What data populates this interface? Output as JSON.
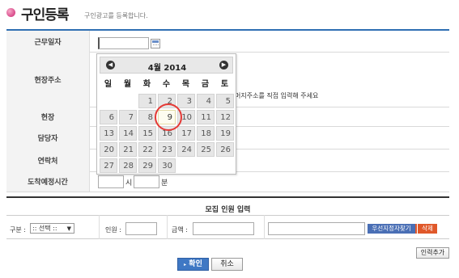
{
  "page": {
    "title": "구인등록",
    "subtitle": "구인광고를 등록합니다."
  },
  "form": {
    "work_date_label": "근무일자",
    "site_address_label": "현장주소",
    "address_hint": "머지주소를 직접 입력해 주세요",
    "site_label": "현장",
    "manager_label": "담당자",
    "contact_label": "연락처",
    "arrival_time_label": "도착예정시간",
    "hour_unit": "시",
    "minute_unit": "분"
  },
  "datepicker": {
    "title": "4월 2014",
    "prev": "◀",
    "next": "▶",
    "weekdays": [
      "일",
      "월",
      "화",
      "수",
      "목",
      "금",
      "토"
    ],
    "selected_day": "9",
    "weeks": [
      [
        "",
        "",
        "1",
        "2",
        "3",
        "4",
        "5"
      ],
      [
        "6",
        "7",
        "8",
        "9",
        "10",
        "11",
        "12"
      ],
      [
        "13",
        "14",
        "15",
        "16",
        "17",
        "18",
        "19"
      ],
      [
        "20",
        "21",
        "22",
        "23",
        "24",
        "25",
        "26"
      ],
      [
        "27",
        "28",
        "29",
        "30",
        "",
        "",
        ""
      ]
    ]
  },
  "recruit": {
    "section_title": "모집 인원 입력",
    "category_label": "구분 :",
    "category_select": ":: 선택 ::",
    "headcount_label": "인원 :",
    "amount_label": "금액 :",
    "find_route_button": "우선지정자찾기",
    "delete_button": "삭제",
    "add_input_button": "인력추가"
  },
  "actions": {
    "confirm": "확인",
    "cancel": "취소"
  },
  "colors": {
    "accent_blue": "#2f6fb3",
    "highlight_circle": "#e53935",
    "delete_orange": "#e0582a"
  }
}
